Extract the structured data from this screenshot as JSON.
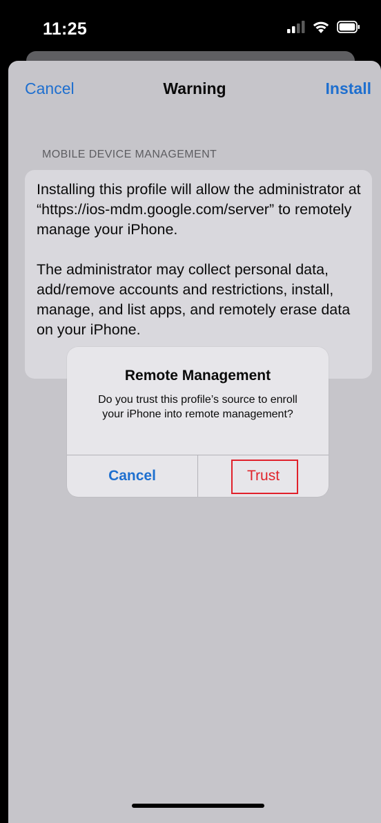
{
  "status_bar": {
    "time": "11:25",
    "icons": [
      "signal-icon",
      "wifi-icon",
      "battery-icon"
    ]
  },
  "nav": {
    "cancel_label": "Cancel",
    "title": "Warning",
    "install_label": "Install"
  },
  "section": {
    "header": "MOBILE DEVICE MANAGEMENT",
    "body": "Installing this profile will allow the administrator at “https://ios-mdm.google.com/server” to remotely manage your iPhone.\n\nThe administrator may collect personal data, add/remove accounts and restrictions, install, manage, and list apps, and remotely erase data on your iPhone."
  },
  "alert": {
    "title": "Remote Management",
    "message": "Do you trust this profile’s source to enroll your iPhone into remote management?",
    "cancel_label": "Cancel",
    "trust_label": "Trust"
  },
  "colors": {
    "accent_blue": "#1e6fcf",
    "destructive_red": "#e0242b",
    "highlight_red": "#e0202a"
  }
}
